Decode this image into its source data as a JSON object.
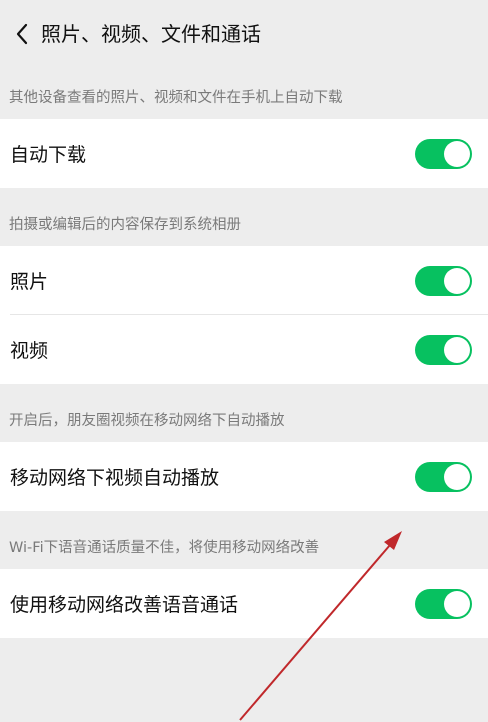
{
  "header": {
    "back_icon": "chevron-left-icon",
    "title": "照片、视频、文件和通话"
  },
  "sections": [
    {
      "note": "其他设备查看的照片、视频和文件在手机上自动下载",
      "rows": [
        {
          "label": "自动下载",
          "toggle_on": true
        }
      ]
    },
    {
      "note": "拍摄或编辑后的内容保存到系统相册",
      "rows": [
        {
          "label": "照片",
          "toggle_on": true
        },
        {
          "label": "视频",
          "toggle_on": true
        }
      ]
    },
    {
      "note": "开启后，朋友圈视频在移动网络下自动播放",
      "rows": [
        {
          "label": "移动网络下视频自动播放",
          "toggle_on": true
        }
      ]
    },
    {
      "note": "Wi-Fi下语音通话质量不佳，将使用移动网络改善",
      "rows": [
        {
          "label": "使用移动网络改善语音通话",
          "toggle_on": true
        }
      ]
    }
  ],
  "colors": {
    "page_bg": "#ededed",
    "toggle_on": "#07c160",
    "annotation_arrow": "#c0282b"
  }
}
